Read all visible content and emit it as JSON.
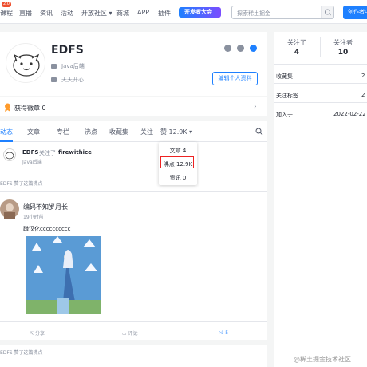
{
  "nav": {
    "items": [
      "课程",
      "直播",
      "资讯",
      "活动",
      "开放社区 ▾",
      "商城",
      "APP",
      "插件"
    ],
    "new_badge": "2.0",
    "dev_conf": "开发者大会",
    "search_placeholder": "探索稀土掘金",
    "create_btn": "创作者中"
  },
  "profile": {
    "name": "EDFS",
    "job": "Java后端",
    "bio": "天天开心",
    "edit_btn": "编辑个人资料"
  },
  "medal": {
    "label": "获得徽章 0"
  },
  "tabs": [
    "动态",
    "文章",
    "专栏",
    "沸点",
    "收藏集",
    "关注",
    "赞 12.9K ▾"
  ],
  "dropdown": [
    "文章 4",
    "沸点 12.9K",
    "资讯 0"
  ],
  "feed": {
    "follow_user": "EDFS",
    "follow_action": "关注了",
    "follow_target": "firewithice",
    "follow_job": "Java后端",
    "liked1": "EDFS 赞了这篇沸点",
    "post_author": "编码不知岁月长",
    "post_time": "19小时前",
    "post_text": "蹲汉化cccccccccc",
    "share": "分享",
    "comment": "评论",
    "like_count": "5",
    "liked2": "EDFS 赞了这篇沸点"
  },
  "sidebar": {
    "following_label": "关注了",
    "following_num": "4",
    "followers_label": "关注者",
    "followers_num": "10",
    "collections_label": "收藏集",
    "collections_num": "2",
    "tags_label": "关注标签",
    "tags_num": "2",
    "joined_label": "加入于",
    "joined_date": "2022-02-22"
  },
  "watermark": "@稀土掘金技术社区",
  "colors": {
    "accent": "#1e80ff",
    "highlight": "#e22222"
  }
}
